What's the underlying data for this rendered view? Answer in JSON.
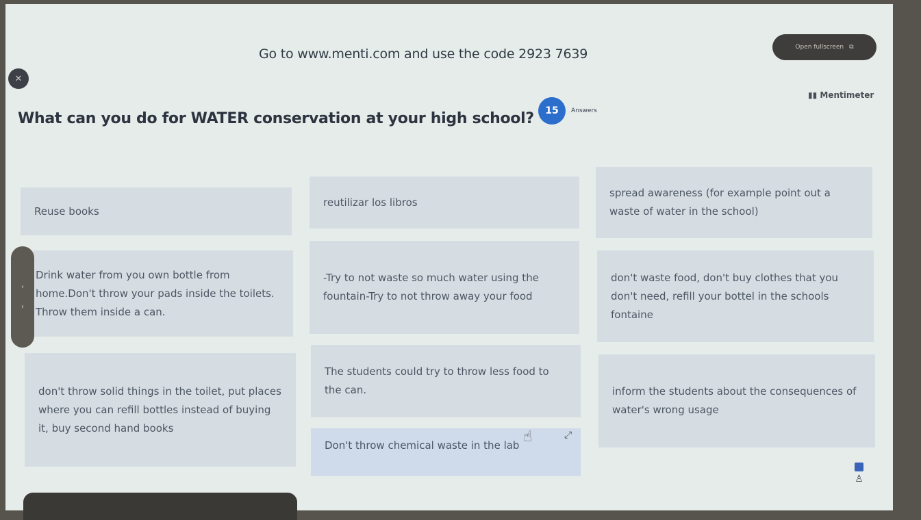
{
  "header": {
    "join_text": "Go to www.menti.com and use the code 2923 7639",
    "fullscreen_label": "Open fullscreen",
    "brand": "Mentimeter"
  },
  "question": {
    "text": "What can you do for WATER conservation at your high school?",
    "answer_count": "15",
    "answer_label": "Answers"
  },
  "responses": [
    {
      "text": "Reuse books"
    },
    {
      "text": "reutilizar los libros"
    },
    {
      "text": "spread awareness (for example point out a waste of water in the school)"
    },
    {
      "text": "Drink water from you own bottle from home.Don't throw your pads inside the toilets. Throw them inside a can."
    },
    {
      "text": "-Try to not waste so much water using the fountain-Try to not throw away your food"
    },
    {
      "text": "don't waste food, don't buy clothes that you don't need, refill your bottel in the schools fontaine"
    },
    {
      "text": "don't throw solid things in the toilet, put places where you can refill bottles instead of buying it, buy second hand books"
    },
    {
      "text": "The students could try to throw less food to the can."
    },
    {
      "text": "inform the students about the consequences of water's wrong usage"
    },
    {
      "text": "Don't throw chemical waste in the lab"
    }
  ],
  "icons": {
    "close": "close-icon",
    "side_up": "chevron-up-icon",
    "side_down": "chevron-down-icon",
    "cursor": "hand-cursor-icon",
    "expand": "expand-icon",
    "person": "person-icon"
  },
  "colors": {
    "accent": "#2b6ecb",
    "screen_bg": "#e6ece9",
    "card_bg": "#d6dde2"
  }
}
